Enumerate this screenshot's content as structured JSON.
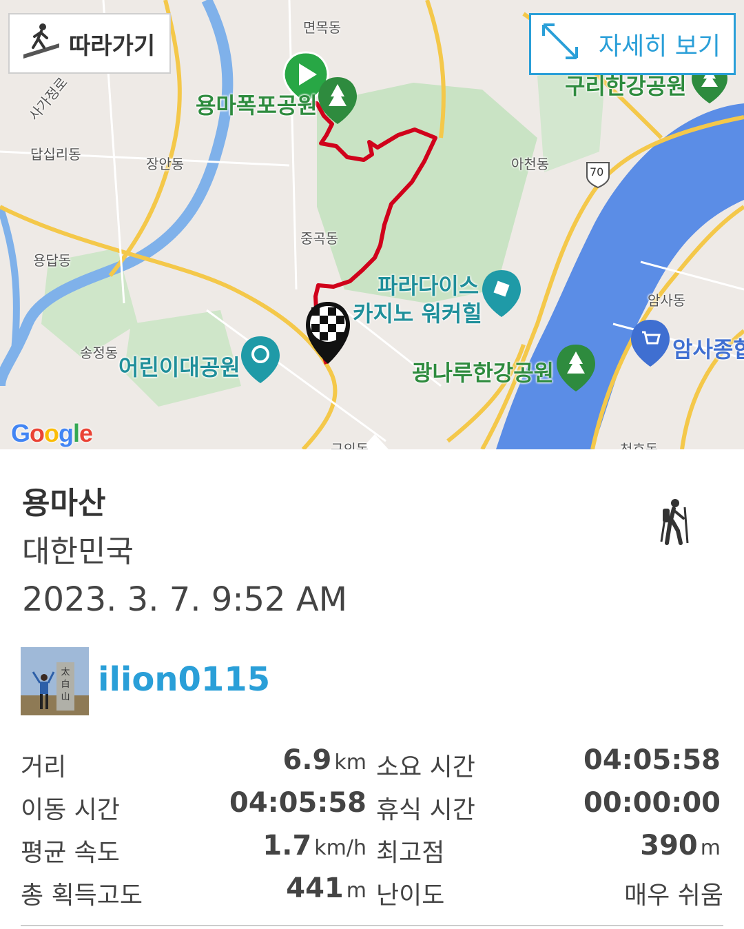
{
  "map": {
    "follow_label": "따라가기",
    "detail_label": "자세히 보기",
    "google_logo": "Google",
    "labels": {
      "myeonmok": "면목동",
      "sagajeong": "사가정로",
      "yongmafalls": "용마폭포공원",
      "guri_park": "구리한강공원",
      "dapsimni": "답십리동",
      "jangan": "장안동",
      "acheon": "아천동",
      "road70": "70",
      "junggok": "중곡동",
      "yongdap": "용답동",
      "paradise1": "파라다이스",
      "paradise2": "카지노 워커힐",
      "amsa": "암사동",
      "amsa_market": "암사종합",
      "songjeong": "송정동",
      "childrens_park": "어린이대공원",
      "gwangnaru": "광나루한강공원",
      "cheonho": "천호동",
      "guui": "구의동"
    }
  },
  "track": {
    "name": "용마산",
    "country": "대한민국",
    "datetime": "2023. 3. 7. 9:52 AM",
    "activity_icon": "hiker-icon",
    "user": {
      "name": "ilion0115",
      "avatar": "user-avatar"
    }
  },
  "stats": [
    {
      "label": "거리",
      "value": "6.9",
      "unit": "km"
    },
    {
      "label": "소요 시간",
      "value": "04:05:58",
      "unit": ""
    },
    {
      "label": "이동 시간",
      "value": "04:05:58",
      "unit": ""
    },
    {
      "label": "휴식 시간",
      "value": "00:00:00",
      "unit": ""
    },
    {
      "label": "평균 속도",
      "value": "1.7",
      "unit": "km/h"
    },
    {
      "label": "최고점",
      "value": "390",
      "unit": "m"
    },
    {
      "label": "총 획득고도",
      "value": "441",
      "unit": "m"
    },
    {
      "label": "난이도",
      "value": "매우 쉬움",
      "unit": ""
    }
  ],
  "colors": {
    "accent": "#2a9fd8",
    "track": "#d0021b",
    "river": "#5b8de6",
    "park": "#c9e3c4"
  }
}
